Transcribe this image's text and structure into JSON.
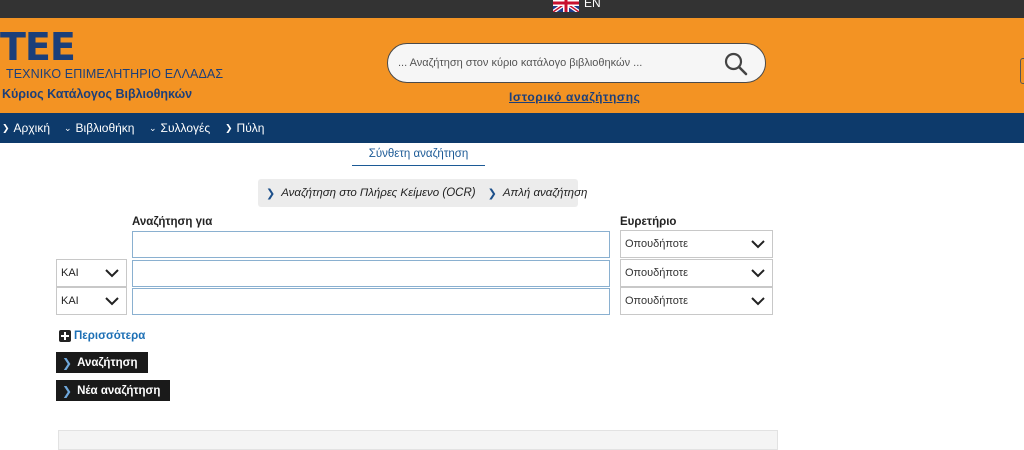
{
  "language": {
    "label": "EN"
  },
  "header": {
    "logo_mark": "ΤΕΕ",
    "logo_subtitle": "ΤΕΧΝΙΚΟ ΕΠΙΜΕΛΗΤΗΡΙΟ ΕΛΛΑΔΑΣ",
    "catalog_name": "Κύριος Κατάλογος Βιβλιοθηκών",
    "search_placeholder": "... Αναζήτηση στον κύριο κατάλογο βιβλιοθηκών ...",
    "history_link": "Ιστορικό αναζήτησης"
  },
  "nav": {
    "items": [
      {
        "label": "Αρχική"
      },
      {
        "label": "Βιβλιοθήκη"
      },
      {
        "label": "Συλλογές"
      },
      {
        "label": "Πύλη"
      }
    ]
  },
  "main": {
    "active_tab": "Σύνθετη αναζήτηση",
    "links": [
      {
        "label": "Αναζήτηση στο Πλήρες Κείμενο (OCR)"
      },
      {
        "label": "Απλή αναζήτηση"
      }
    ],
    "search_for_label": "Αναζήτηση για",
    "index_label": "Ευρετήριο",
    "rows": [
      {
        "operator": "",
        "term": "",
        "index": "Οπουδήποτε"
      },
      {
        "operator": "ΚΑΙ",
        "term": "",
        "index": "Οπουδήποτε"
      },
      {
        "operator": "ΚΑΙ",
        "term": "",
        "index": "Οπουδήποτε"
      }
    ],
    "more_label": "Περισσότερα",
    "search_button": "Αναζήτηση",
    "new_search_button": "Νέα αναζήτηση"
  },
  "colors": {
    "header_bg": "#f39323",
    "nav_bg": "#0d3a6b",
    "top_strip": "#333333",
    "brand_blue": "#1c3f7a"
  },
  "icons": {
    "flag": "uk-flag-icon",
    "search": "magnifier-icon",
    "dropdown": "chevron-down-icon",
    "nav": "chevron-right-icon",
    "more": "plus-box-icon"
  }
}
